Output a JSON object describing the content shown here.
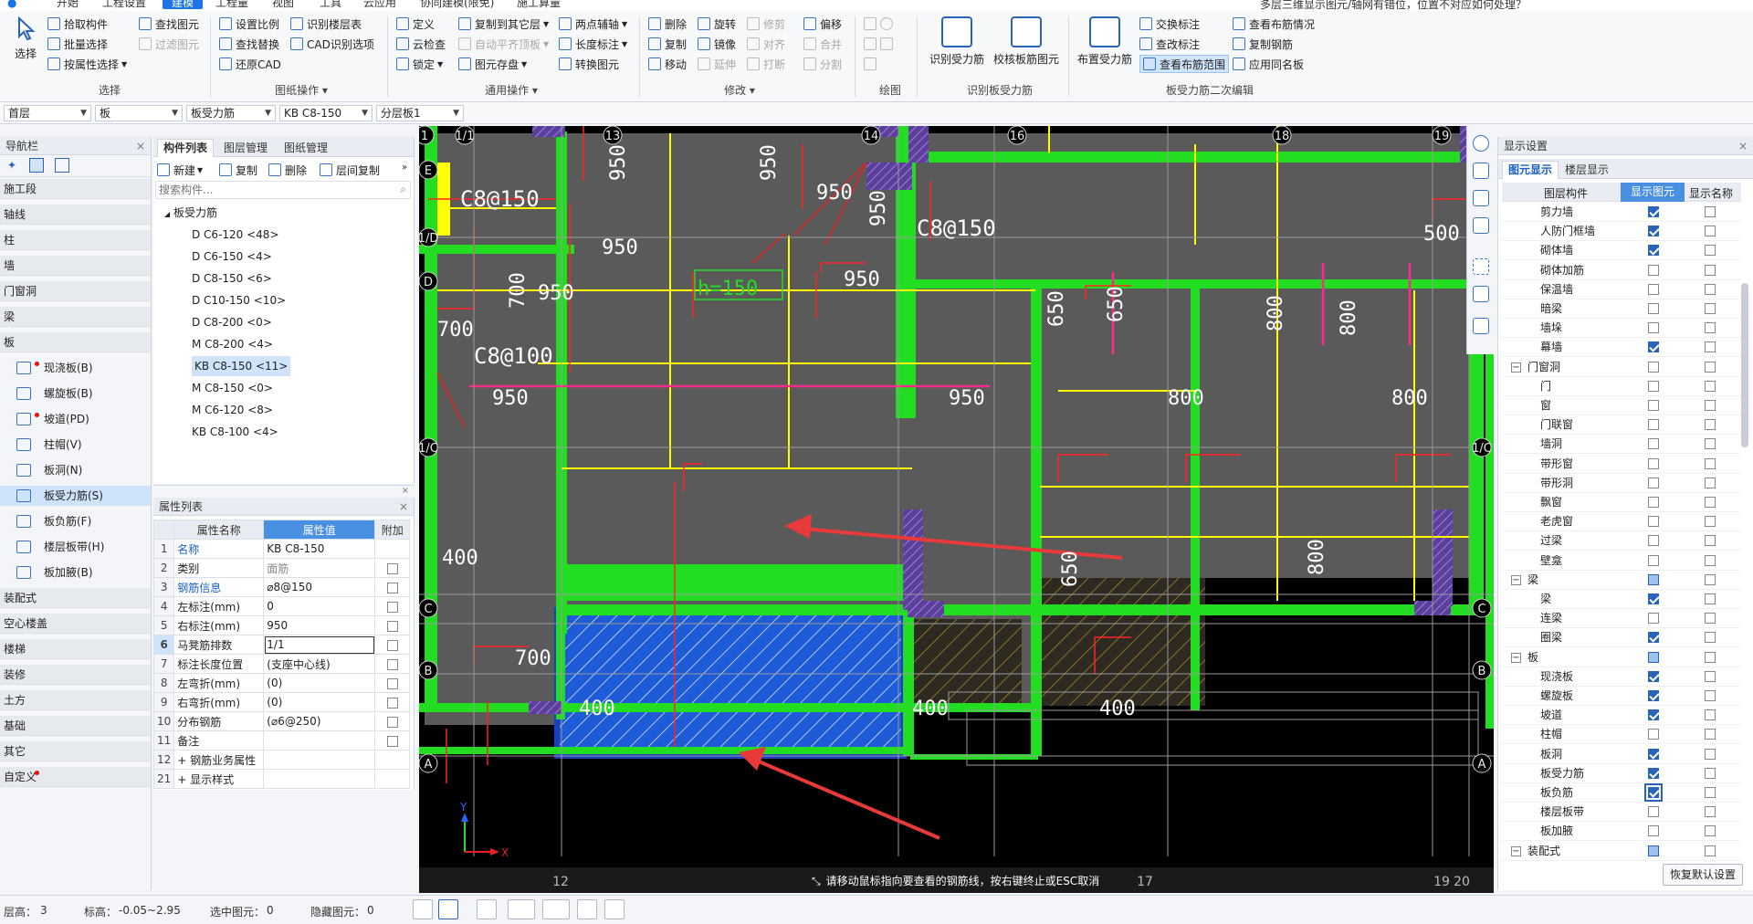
{
  "menubar": {
    "items": [
      "开始",
      "工程设置",
      "建模",
      "工程量",
      "视图",
      "工具",
      "云应用",
      "协同建模(限免)",
      "施工算量"
    ],
    "active_index": 2,
    "hint": "多层三维显示图元/轴网有错位，位置不对应如何处理？"
  },
  "ribbon": {
    "groups": [
      {
        "title": "选择",
        "big": "选择",
        "items": [
          "拾取构件",
          "批量选择",
          "按属性选择"
        ]
      },
      {
        "title": "",
        "items": [
          "查找图元",
          "过滤图元"
        ]
      },
      {
        "title": "图纸操作",
        "items": [
          "设置比例",
          "查找替换",
          "还原CAD",
          "识别楼层表",
          "CAD识别选项"
        ]
      },
      {
        "title": "通用操作",
        "items": [
          "定义",
          "云检查",
          "锁定",
          "复制到其它层",
          "自动平齐顶板",
          "图元存盘",
          "两点辅轴",
          "长度标注",
          "转换图元"
        ]
      },
      {
        "title": "修改",
        "items": [
          "删除",
          "旋转",
          "修剪",
          "偏移",
          "复制",
          "镜像",
          "对齐",
          "合并",
          "移动",
          "延伸",
          "打断",
          "分割"
        ]
      },
      {
        "title": "绘图",
        "items": []
      },
      {
        "title": "识别板受力筋",
        "items": [
          "识别受力筋",
          "校核板筋图元"
        ]
      },
      {
        "title": "板受力筋二次编辑",
        "items": [
          "布置受力筋",
          "交换标注",
          "查改标注",
          "查看布筋范围",
          "查看布筋情况",
          "复制钢筋",
          "应用同名板"
        ]
      }
    ]
  },
  "selbar": {
    "floor": "首层",
    "type": "板",
    "sub": "板受力筋",
    "name": "KB C8-150",
    "layer": "分层板1"
  },
  "nav": {
    "title": "导航栏",
    "items": [
      {
        "label": "施工段",
        "kind": "cat"
      },
      {
        "label": "轴线",
        "kind": "cat"
      },
      {
        "label": "柱",
        "kind": "cat"
      },
      {
        "label": "墙",
        "kind": "cat"
      },
      {
        "label": "门窗洞",
        "kind": "cat"
      },
      {
        "label": "梁",
        "kind": "cat"
      },
      {
        "label": "板",
        "kind": "cat"
      },
      {
        "label": "现浇板(B)",
        "kind": "sub",
        "dot": true
      },
      {
        "label": "螺旋板(B)",
        "kind": "sub"
      },
      {
        "label": "坡道(PD)",
        "kind": "sub",
        "dot": true
      },
      {
        "label": "柱帽(V)",
        "kind": "sub"
      },
      {
        "label": "板洞(N)",
        "kind": "sub"
      },
      {
        "label": "板受力筋(S)",
        "kind": "sub",
        "selected": true
      },
      {
        "label": "板负筋(F)",
        "kind": "sub"
      },
      {
        "label": "楼层板带(H)",
        "kind": "sub"
      },
      {
        "label": "板加腋(B)",
        "kind": "sub"
      },
      {
        "label": "装配式",
        "kind": "cat"
      },
      {
        "label": "空心楼盖",
        "kind": "cat"
      },
      {
        "label": "楼梯",
        "kind": "cat"
      },
      {
        "label": "装修",
        "kind": "cat"
      },
      {
        "label": "土方",
        "kind": "cat"
      },
      {
        "label": "基础",
        "kind": "cat"
      },
      {
        "label": "其它",
        "kind": "cat"
      },
      {
        "label": "自定义",
        "kind": "cat",
        "dot": true
      }
    ]
  },
  "complist": {
    "tabs": [
      "构件列表",
      "图层管理",
      "图纸管理"
    ],
    "toolbar": [
      "新建",
      "复制",
      "删除",
      "层间复制"
    ],
    "search_placeholder": "搜索构件...",
    "root": "板受力筋",
    "items": [
      "D C6-120 <48>",
      "D C6-150 <4>",
      "D C8-150 <6>",
      "D C10-150 <10>",
      "D C8-200 <0>",
      "M C8-200 <4>",
      "KB C8-150 <11>",
      "M C8-150 <0>",
      "M C6-120 <8>",
      "KB C8-100 <4>"
    ],
    "selected_index": 6
  },
  "props": {
    "title": "属性列表",
    "headers": [
      "属性名称",
      "属性值",
      "附加"
    ],
    "rows": [
      {
        "n": "1",
        "name": "名称",
        "val": "KB C8-150",
        "blue": true
      },
      {
        "n": "2",
        "name": "类别",
        "val": "面筋",
        "gray": true,
        "cb": true
      },
      {
        "n": "3",
        "name": "钢筋信息",
        "val": "⌀8@150",
        "blue": true,
        "cb": true
      },
      {
        "n": "4",
        "name": "左标注(mm)",
        "val": "0",
        "cb": true
      },
      {
        "n": "5",
        "name": "右标注(mm)",
        "val": "950",
        "cb": true
      },
      {
        "n": "6",
        "name": "马凳筋排数",
        "val": "1/1",
        "cb": true,
        "sel": true
      },
      {
        "n": "7",
        "name": "标注长度位置",
        "val": "(支座中心线)",
        "cb": true
      },
      {
        "n": "8",
        "name": "左弯折(mm)",
        "val": "(0)",
        "cb": true
      },
      {
        "n": "9",
        "name": "右弯折(mm)",
        "val": "(0)",
        "cb": true
      },
      {
        "n": "10",
        "name": "分布钢筋",
        "val": "(⌀6@250)",
        "cb": true
      },
      {
        "n": "11",
        "name": "备注",
        "val": "",
        "cb": true
      },
      {
        "n": "12",
        "name": "+ 钢筋业务属性",
        "val": ""
      },
      {
        "n": "21",
        "name": "+ 显示样式",
        "val": ""
      }
    ]
  },
  "canvas": {
    "axes_top": [
      "1",
      "1/1",
      "13",
      "14",
      "16",
      "18",
      "19",
      "2"
    ],
    "axes_bottom": [
      "12",
      "17",
      "19",
      "20"
    ],
    "axes_left": [
      "E",
      "1/D",
      "D",
      "1/C",
      "C",
      "B",
      "A"
    ],
    "axes_right": [
      "1/C",
      "C",
      "B",
      "A"
    ],
    "dims": [
      "950",
      "950",
      "950",
      "950",
      "950",
      "950",
      "950",
      "700",
      "700",
      "950",
      "650",
      "650",
      "800",
      "800",
      "950",
      "800",
      "800",
      "500",
      "650",
      "800",
      "400",
      "700",
      "400",
      "400",
      "400"
    ],
    "labels": [
      "C8@150",
      "C8@100",
      "C8@150",
      "h=150"
    ],
    "hint": "请移动鼠标指向要查看的钢筋线，按右键终止或ESC取消",
    "colors": {
      "bg": "#000000",
      "slab": "#5a5a5a",
      "wall": "#22dd22",
      "rebar": "#ffff00",
      "neg": "#ff2222",
      "sel": "#1e5bd6",
      "arrow": "#e83a3a"
    }
  },
  "display": {
    "title": "显示设置",
    "tabs": [
      "图元显示",
      "楼层显示"
    ],
    "headers": [
      "图层构件",
      "显示图元",
      "显示名称"
    ],
    "rows": [
      {
        "name": "剪力墙",
        "c1": true,
        "c2": false
      },
      {
        "name": "人防门框墙",
        "c1": true,
        "c2": false
      },
      {
        "name": "砌体墙",
        "c1": true,
        "c2": false
      },
      {
        "name": "砌体加筋",
        "c1": false,
        "c2": false
      },
      {
        "name": "保温墙",
        "c1": false,
        "c2": false
      },
      {
        "name": "暗梁",
        "c1": false,
        "c2": false
      },
      {
        "name": "墙垛",
        "c1": false,
        "c2": false
      },
      {
        "name": "幕墙",
        "c1": true,
        "c2": false
      },
      {
        "name": "门窗洞",
        "c1": false,
        "c2": false,
        "grp": true
      },
      {
        "name": "门",
        "c1": false,
        "c2": false
      },
      {
        "name": "窗",
        "c1": false,
        "c2": false
      },
      {
        "name": "门联窗",
        "c1": false,
        "c2": false
      },
      {
        "name": "墙洞",
        "c1": false,
        "c2": false
      },
      {
        "name": "带形窗",
        "c1": false,
        "c2": false
      },
      {
        "name": "带形洞",
        "c1": false,
        "c2": false
      },
      {
        "name": "飘窗",
        "c1": false,
        "c2": false
      },
      {
        "name": "老虎窗",
        "c1": false,
        "c2": false
      },
      {
        "name": "过梁",
        "c1": false,
        "c2": false
      },
      {
        "name": "壁龛",
        "c1": false,
        "c2": false
      },
      {
        "name": "梁",
        "c1": "part",
        "c2": false,
        "grp": true
      },
      {
        "name": "梁",
        "c1": true,
        "c2": false
      },
      {
        "name": "连梁",
        "c1": false,
        "c2": false
      },
      {
        "name": "圈梁",
        "c1": true,
        "c2": false
      },
      {
        "name": "板",
        "c1": "part",
        "c2": false,
        "grp": true
      },
      {
        "name": "现浇板",
        "c1": true,
        "c2": false
      },
      {
        "name": "螺旋板",
        "c1": true,
        "c2": false
      },
      {
        "name": "坡道",
        "c1": true,
        "c2": false
      },
      {
        "name": "柱帽",
        "c1": false,
        "c2": false
      },
      {
        "name": "板洞",
        "c1": true,
        "c2": false
      },
      {
        "name": "板受力筋",
        "c1": true,
        "c2": false
      },
      {
        "name": "板负筋",
        "c1": true,
        "c2": false,
        "sel": true
      },
      {
        "name": "楼层板带",
        "c1": false,
        "c2": false
      },
      {
        "name": "板加腋",
        "c1": false,
        "c2": false
      },
      {
        "name": "装配式",
        "c1": "part",
        "c2": false,
        "grp": true
      }
    ],
    "reset": "恢复默认设置"
  },
  "status": {
    "floor_h": "层高：",
    "floor_h_val": "3",
    "elev": "标高：",
    "elev_val": "-0.05~2.95",
    "sel": "选中图元：",
    "sel_val": "0",
    "hidden": "隐藏图元：",
    "hidden_val": "0"
  }
}
